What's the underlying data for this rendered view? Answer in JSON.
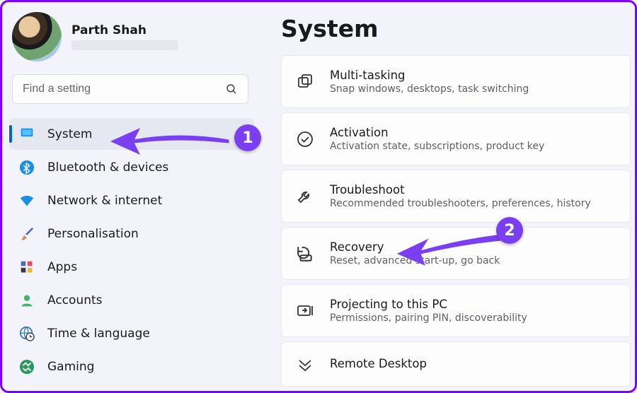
{
  "profile": {
    "name": "Parth Shah"
  },
  "search": {
    "placeholder": "Find a setting"
  },
  "sidebar": {
    "items": [
      {
        "label": "System"
      },
      {
        "label": "Bluetooth & devices"
      },
      {
        "label": "Network & internet"
      },
      {
        "label": "Personalisation"
      },
      {
        "label": "Apps"
      },
      {
        "label": "Accounts"
      },
      {
        "label": "Time & language"
      },
      {
        "label": "Gaming"
      }
    ]
  },
  "main": {
    "title": "System",
    "cards": [
      {
        "title": "Multi-tasking",
        "sub": "Snap windows, desktops, task switching"
      },
      {
        "title": "Activation",
        "sub": "Activation state, subscriptions, product key"
      },
      {
        "title": "Troubleshoot",
        "sub": "Recommended troubleshooters, preferences, history"
      },
      {
        "title": "Recovery",
        "sub": "Reset, advanced start-up, go back"
      },
      {
        "title": "Projecting to this PC",
        "sub": "Permissions, pairing PIN, discoverability"
      },
      {
        "title": "Remote Desktop",
        "sub": ""
      }
    ]
  },
  "annotations": {
    "badge1": "1",
    "badge2": "2",
    "accent": "#7a3ff2"
  }
}
